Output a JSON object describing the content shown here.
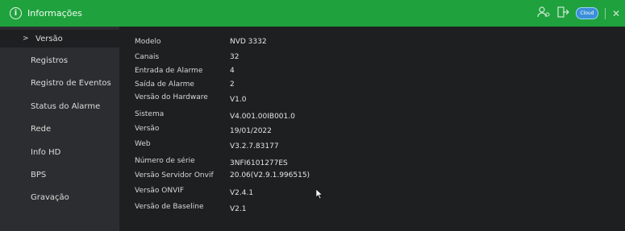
{
  "header": {
    "title": "Informações",
    "cloud_label": "Cloud"
  },
  "sidebar": {
    "items": [
      {
        "label": "Versão",
        "active": true
      },
      {
        "label": "Registros"
      },
      {
        "label": "Registro de Eventos"
      },
      {
        "label": "Status do Alarme"
      },
      {
        "label": "Rede"
      },
      {
        "label": "Info HD"
      },
      {
        "label": "BPS"
      },
      {
        "label": "Gravação"
      }
    ]
  },
  "info": {
    "rows": [
      {
        "label": "Modelo",
        "value": "NVD 3332"
      },
      {
        "label": "Canais",
        "value": "32"
      },
      {
        "label": "Entrada de Alarme",
        "value": "4"
      },
      {
        "label": "Saída de Alarme",
        "value": "2"
      },
      {
        "label": "Versão do Hardware",
        "value": "V1.0"
      },
      {
        "label": "Sistema",
        "value": "V4.001.00IB001.0"
      },
      {
        "label": "Versão",
        "value": "19/01/2022"
      },
      {
        "label": "Web",
        "value": "V3.2.7.83177"
      },
      {
        "label": "Número de série",
        "value": "3NFI6101277ES"
      },
      {
        "label": "Versão Servidor Onvif",
        "value": "20.06(V2.9.1.996515)"
      },
      {
        "label": "Versão ONVIF",
        "value": "V2.4.1"
      },
      {
        "label": "Versão de Baseline",
        "value": "V2.1"
      }
    ]
  },
  "colors": {
    "titlebar": "#1fa23d",
    "sidebar": "#2c2d30",
    "background": "#1e1f21"
  }
}
